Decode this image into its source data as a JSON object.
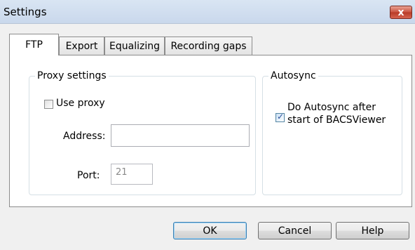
{
  "window": {
    "title": "Settings",
    "close_label": "x"
  },
  "tabs": [
    {
      "label": "FTP",
      "active": true
    },
    {
      "label": "Export",
      "active": false
    },
    {
      "label": "Equalizing",
      "active": false
    },
    {
      "label": "Recording gaps",
      "active": false
    }
  ],
  "proxy": {
    "group_title": "Proxy settings",
    "use_proxy_label": "Use proxy",
    "use_proxy_checked": false,
    "address_label": "Address:",
    "address_value": "",
    "port_label": "Port:",
    "port_value": "21"
  },
  "autosync": {
    "group_title": "Autosync",
    "checkbox_label_line1": "Do Autosync after",
    "checkbox_label_line2": "start of BACSViewer",
    "checked": true
  },
  "buttons": {
    "ok": "OK",
    "cancel": "Cancel",
    "help": "Help"
  },
  "icons": {
    "close": "close-icon",
    "check": "check-icon"
  }
}
